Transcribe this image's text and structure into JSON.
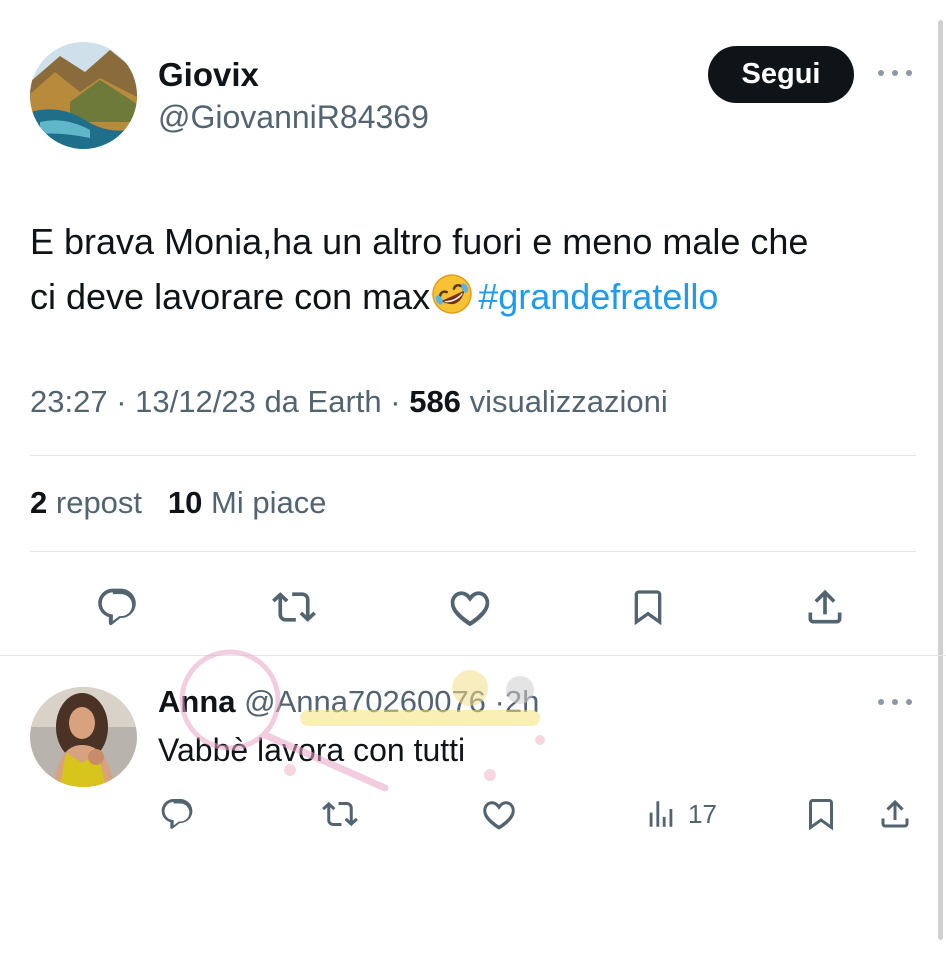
{
  "tweet": {
    "display_name": "Giovix",
    "handle": "@GiovanniR84369",
    "follow_label": "Segui",
    "text_line1": "E brava Monia,ha un altro fuori e meno male che",
    "text_line2_prefix": "ci deve lavorare con max",
    "emoji": "rolling-on-floor-laughing",
    "hashtag": "#grandefratello",
    "time": "23:27",
    "date": "13/12/23",
    "source": "da Earth",
    "views_count": "586",
    "views_label": "visualizzazioni",
    "reposts_count": "2",
    "reposts_label": "repost",
    "likes_count": "10",
    "likes_label": "Mi piace",
    "actions": [
      "reply-icon",
      "repost-icon",
      "like-icon",
      "bookmark-icon",
      "share-icon"
    ]
  },
  "reply": {
    "display_name": "Anna",
    "handle": "@Anna70260076",
    "time": "2h",
    "text": "Vabbè lavora con tutti",
    "views_count": "17",
    "actions": [
      "reply-icon",
      "repost-icon",
      "like-icon",
      "views-icon",
      "bookmark-icon",
      "share-icon"
    ]
  },
  "colors": {
    "text": "#0f1419",
    "secondary": "#536471",
    "hashtag": "#1d9bf0",
    "follow_bg": "#0f1419",
    "divider": "#e4e8eb"
  }
}
